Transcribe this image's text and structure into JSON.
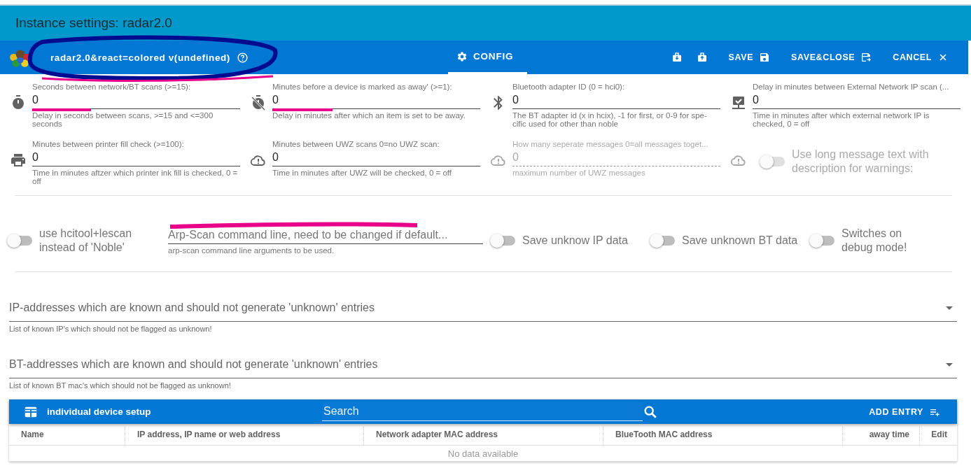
{
  "window": {
    "title": "Instance settings: radar2.0"
  },
  "toolbar": {
    "adapter_title": "radar2.0&react=colored v(undefined)",
    "tabs": [
      {
        "label": "CONFIG",
        "selected": true
      }
    ],
    "buttons": [
      {
        "kind": "import"
      },
      {
        "kind": "export"
      },
      {
        "kind": "save",
        "label": "SAVE"
      },
      {
        "kind": "saveclose",
        "label": "SAVE&CLOSE"
      },
      {
        "kind": "cancel",
        "label": "CANCEL"
      }
    ]
  },
  "settings_rows": [
    [
      {
        "kind": "text",
        "label": "Seconds between network/BT scans (>=15):",
        "value": "0",
        "helper": "Delay in seconds between scans, >=15 and <=300 seconds",
        "disabled": false
      },
      {
        "kind": "text",
        "label": "Minutes before a device is marked as away' (>=1):",
        "value": "0",
        "helper": "Delay in minutes after which an item is set to be away.",
        "disabled": false
      },
      {
        "kind": "text",
        "label": "Bluetooth adapter ID (0 = hci0):",
        "value": "0",
        "helper": "The BT adapter id (x in hcix), -1 for first, or 0-9 for spe-cific used for other than noble",
        "disabled": false
      },
      {
        "kind": "text",
        "label": "Delay in minutes between External Network IP scan (...",
        "value": "0",
        "helper": "Time in minutes after which external network IP is checked, 0 = off",
        "disabled": false
      }
    ],
    [
      {
        "kind": "text",
        "label": "Minutes between printer fill check (>=100):",
        "value": "0",
        "helper": "Time in minutes aftzer which printer ink fill is checked, 0 = off",
        "disabled": false
      },
      {
        "kind": "text",
        "label": "Minutes between UWZ scans 0=no UWZ scan:",
        "value": "0",
        "helper": "Time in minutes after UWZ will be checked, 0 = off",
        "disabled": false
      },
      {
        "kind": "text",
        "label": "How many seperate messages 0=all messages toget...",
        "value": "0",
        "helper": "maximum number of UWZ messages",
        "disabled": true
      },
      {
        "kind": "switch",
        "label": "Use long message text with description for warnings:",
        "on": false,
        "disabled": true
      }
    ],
    [
      {
        "kind": "switch",
        "label": "use hcitool+lescan instead of 'Noble'",
        "on": false,
        "disabled": false
      },
      {
        "kind": "text",
        "placeholder": "Arp-Scan command line, need to be changed if default...",
        "helper": "arp-scan command line arguments to be used.",
        "disabled": false
      },
      {
        "kind": "switch",
        "label": "Save unknow IP data",
        "on": false,
        "disabled": false
      },
      {
        "kind": "switch",
        "label": "Save unknown BT data",
        "on": false,
        "disabled": false
      },
      {
        "kind": "switch",
        "label": "Switches on debug mode!",
        "on": false,
        "disabled": false
      }
    ]
  ],
  "selects": [
    {
      "label": "IP-addresses which are known and should not generate 'unknown' entries",
      "helper": "List of known IP's which should not be flagged as unknown!"
    },
    {
      "label": "BT-addresses which are known and should not generate 'unknown' entries",
      "helper": "List of known BT mac's which should not be flagged as unknown!"
    }
  ],
  "table": {
    "title": "individual device setup",
    "search_placeholder": "Search",
    "add_button": "ADD ENTRY",
    "columns": [
      "Name",
      "IP address, IP name or web address",
      "Network adapter MAC address",
      "BlueTooth MAC address",
      "away time",
      "Edit"
    ],
    "empty_text": "No data available"
  }
}
